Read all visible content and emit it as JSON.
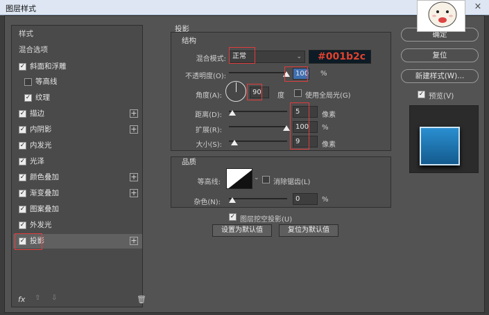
{
  "window": {
    "title": "图层样式",
    "close": "×"
  },
  "left_panel": {
    "items": [
      {
        "label": "样式",
        "checked": null,
        "plus": false
      },
      {
        "label": "混合选项",
        "checked": null,
        "plus": false
      },
      {
        "label": "斜面和浮雕",
        "checked": true,
        "plus": false
      },
      {
        "label": "等高线",
        "checked": false,
        "plus": false
      },
      {
        "label": "纹理",
        "checked": true,
        "plus": false
      },
      {
        "label": "描边",
        "checked": true,
        "plus": true
      },
      {
        "label": "内阴影",
        "checked": true,
        "plus": true
      },
      {
        "label": "内发光",
        "checked": true,
        "plus": false
      },
      {
        "label": "光泽",
        "checked": true,
        "plus": false
      },
      {
        "label": "颜色叠加",
        "checked": true,
        "plus": true
      },
      {
        "label": "渐变叠加",
        "checked": true,
        "plus": true
      },
      {
        "label": "图案叠加",
        "checked": true,
        "plus": false
      },
      {
        "label": "外发光",
        "checked": true,
        "plus": false
      },
      {
        "label": "投影",
        "checked": true,
        "plus": true
      }
    ],
    "fx": "fx",
    "up": "⇧",
    "down": "⇩",
    "trash": "🗑",
    "check_mark": "✓",
    "plus_mark": "+"
  },
  "drop_shadow": {
    "title": "投影",
    "structure": {
      "title": "结构",
      "blend_mode_label": "混合模式:",
      "blend_mode_value": "正常",
      "color_hex": "#001b2c",
      "opacity_label": "不透明度(O):",
      "opacity_value": "100",
      "opacity_unit": "%",
      "angle_label": "角度(A):",
      "angle_value": "90",
      "angle_unit": "度",
      "global_light_label": "使用全局光(G)",
      "distance_label": "距离(D):",
      "distance_value": "5",
      "distance_unit": "像素",
      "spread_label": "扩展(R):",
      "spread_value": "100",
      "spread_unit": "%",
      "size_label": "大小(S):",
      "size_value": "9",
      "size_unit": "像素"
    },
    "quality": {
      "title": "品质",
      "contour_label": "等高线:",
      "antialias_label": "消除锯齿(L)",
      "noise_label": "杂色(N):",
      "noise_value": "0",
      "noise_unit": "%"
    },
    "knockout_label": "图层挖空投影(U)",
    "set_default": "设置为默认值",
    "reset_default": "复位为默认值"
  },
  "right_panel": {
    "ok": "确定",
    "reset": "复位",
    "new_style": "新建样式(W)...",
    "preview_label": "预览(V)",
    "preview_color": "#1f7bbd"
  },
  "colors": {
    "accent_red": "#e23c3c",
    "hex_text": "#e0422e",
    "dialog_bg": "#535353"
  }
}
